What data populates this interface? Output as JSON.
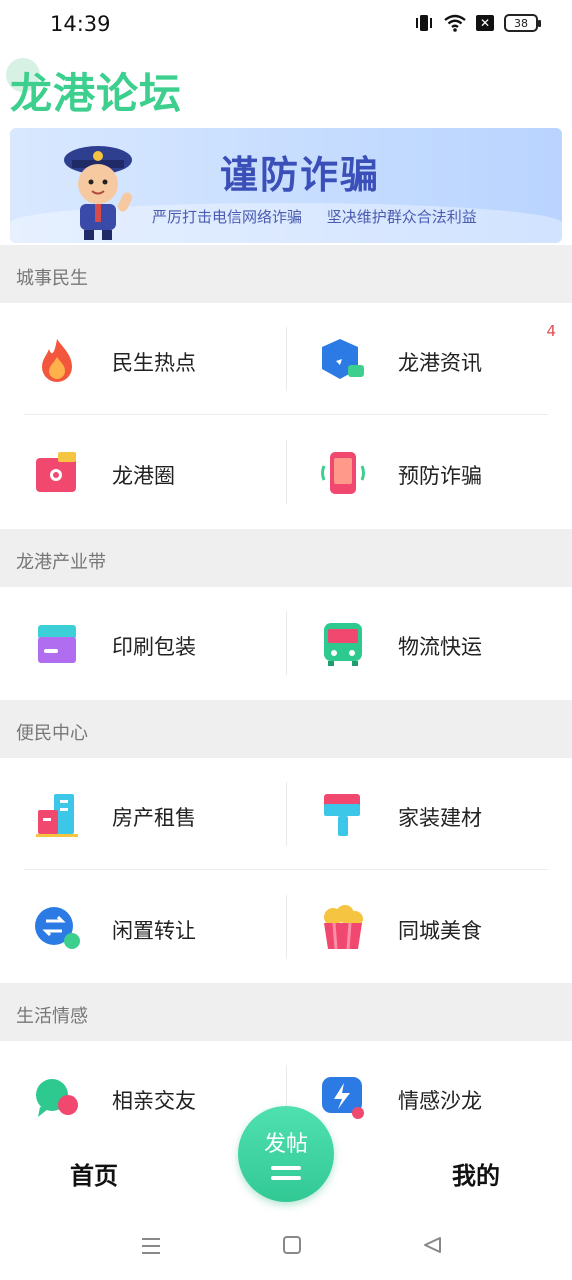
{
  "status_bar": {
    "time": "14:39",
    "battery": "38",
    "x_badge": "✕"
  },
  "app": {
    "title": "龙港论坛"
  },
  "banner": {
    "title": "谨防诈骗",
    "subtitle": "严厉打击电信网络诈骗  坚决维护群众合法利益"
  },
  "sections": [
    {
      "title": "城事民生",
      "items": [
        {
          "label": "民生热点",
          "icon": "flame-icon"
        },
        {
          "label": "龙港资讯",
          "icon": "news-cube-icon",
          "badge": "4"
        },
        {
          "label": "龙港圈",
          "icon": "wallet-circle-icon"
        },
        {
          "label": "预防诈骗",
          "icon": "phone-vibrate-icon"
        }
      ]
    },
    {
      "title": "龙港产业带",
      "items": [
        {
          "label": "印刷包装",
          "icon": "package-box-icon"
        },
        {
          "label": "物流快运",
          "icon": "bus-icon"
        }
      ]
    },
    {
      "title": "便民中心",
      "items": [
        {
          "label": "房产租售",
          "icon": "buildings-icon"
        },
        {
          "label": "家装建材",
          "icon": "paint-roller-icon"
        },
        {
          "label": "闲置转让",
          "icon": "swap-arrows-icon"
        },
        {
          "label": "同城美食",
          "icon": "popcorn-icon"
        }
      ]
    },
    {
      "title": "生活情感",
      "items": [
        {
          "label": "相亲交友",
          "icon": "chat-bubbles-icon"
        },
        {
          "label": "情感沙龙",
          "icon": "lightning-chat-icon"
        }
      ]
    }
  ],
  "tabs": {
    "home": "首页",
    "post": "发帖",
    "mine": "我的"
  },
  "colors": {
    "brand": "#3ccf8e",
    "banner_text": "#3b4fb8",
    "badge": "#e05050",
    "section_bg": "#efefef"
  }
}
